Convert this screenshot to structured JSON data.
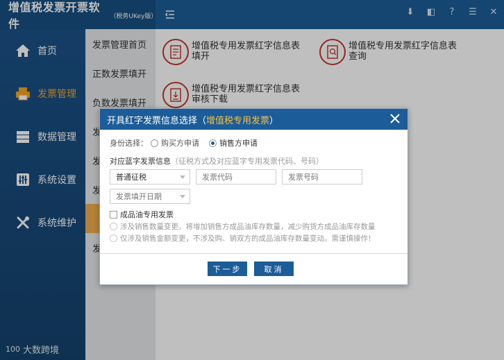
{
  "app": {
    "title": "增值税发票开票软件",
    "subtitle": "（税务UKey版）"
  },
  "window_controls": [
    "down-arrow-icon",
    "fullscreen-icon",
    "help-icon",
    "menu-icon",
    "close-icon"
  ],
  "window_controls_text": [
    "⬇",
    "◧",
    "?",
    "☰",
    "✕"
  ],
  "leftnav": {
    "items": [
      {
        "label": "首页",
        "icon": "home-icon"
      },
      {
        "label": "发票管理",
        "icon": "printer-icon",
        "active": true
      },
      {
        "label": "数据管理",
        "icon": "database-icon"
      },
      {
        "label": "系统设置",
        "icon": "sliders-icon"
      },
      {
        "label": "系统维护",
        "icon": "tools-icon"
      }
    ],
    "footer": "大数跨境",
    "footer_logo": "100"
  },
  "subnav": {
    "items": [
      {
        "label": "发票管理首页"
      },
      {
        "label": "正数发票填开"
      },
      {
        "label": "负数发票填开"
      },
      {
        "label": "发"
      },
      {
        "label": "发"
      },
      {
        "label": "发"
      },
      {
        "label": "",
        "active": true
      },
      {
        "label": "发"
      }
    ]
  },
  "content": {
    "cards": [
      {
        "label": "增值税专用发票红字信息表填开"
      },
      {
        "label": "增值税专用发票红字信息表查询"
      },
      {
        "label": "增值税专用发票红字信息表审核下载"
      }
    ]
  },
  "dialog": {
    "title": "开具红字发票信息选择（",
    "title_highlight": "增值税专用发票",
    "title_end": "）",
    "identity_label": "身份选择：",
    "identity_options": [
      {
        "label": "购买方申请",
        "selected": false
      },
      {
        "label": "销售方申请",
        "selected": true
      }
    ],
    "blue_info_label": "对应蓝字发票信息",
    "blue_info_hint": "（征税方式及对应蓝字专用发票代码、号码）",
    "tax_method": {
      "value": "普通征税"
    },
    "invoice_code": {
      "placeholder": "发票代码"
    },
    "invoice_number": {
      "placeholder": "发票号码"
    },
    "issue_date": {
      "placeholder": "发票填开日期"
    },
    "oil_checkbox": {
      "label": "成品油专用发票",
      "checked": false
    },
    "oil_options": [
      "涉及销售数量变更，将增加销售方成品油库存数量，减少购货方成品油库存数量",
      "仅涉及销售金额变更，不涉及购、销双方的成品油库存数量变动。需谨慎操作！"
    ],
    "next_button": "下一步",
    "cancel_button": "取消"
  }
}
